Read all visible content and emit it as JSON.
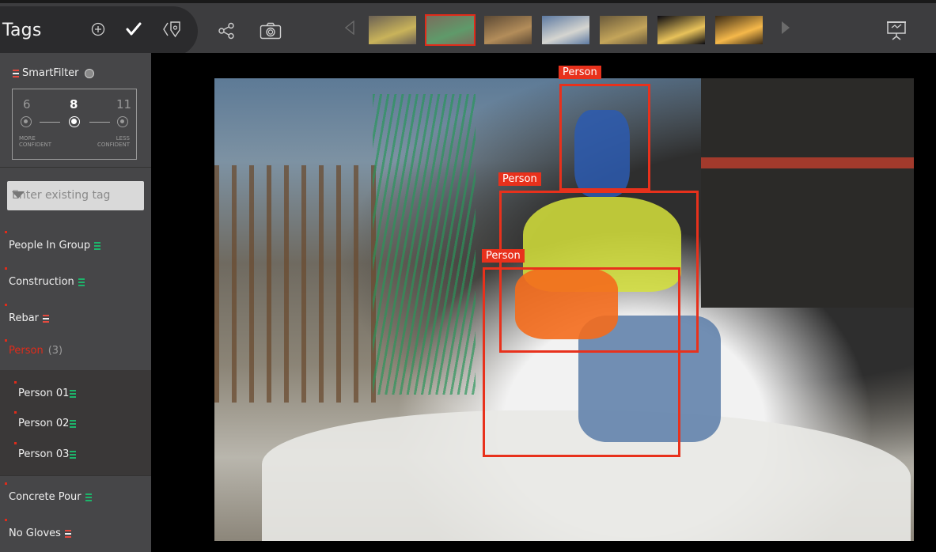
{
  "header": {
    "title": "Tags",
    "icons": [
      "add-circle-icon",
      "check-icon",
      "tag-location-icon",
      "share-icon",
      "camera-icon",
      "prev-arrow-icon",
      "next-arrow-icon",
      "presentation-icon"
    ]
  },
  "thumbnails": [
    {
      "name": "thumb-1",
      "active": false,
      "colors": [
        "#6b6154",
        "#c9b35a"
      ]
    },
    {
      "name": "thumb-2",
      "active": true,
      "colors": [
        "#7a6e5d",
        "#5f9a6a"
      ]
    },
    {
      "name": "thumb-3",
      "active": false,
      "colors": [
        "#5d4a35",
        "#b38d5a"
      ]
    },
    {
      "name": "thumb-4",
      "active": false,
      "colors": [
        "#5d7aa2",
        "#d5d5d0"
      ]
    },
    {
      "name": "thumb-5",
      "active": false,
      "colors": [
        "#6a5a3b",
        "#c4a55a"
      ]
    },
    {
      "name": "thumb-6",
      "active": false,
      "colors": [
        "#0a0a12",
        "#e8c25a"
      ]
    },
    {
      "name": "thumb-7",
      "active": false,
      "colors": [
        "#3a2a16",
        "#f5b84a"
      ]
    }
  ],
  "smartfilter": {
    "label": "SmartFilter",
    "values": [
      "6",
      "8",
      "11"
    ],
    "selected_index": 1,
    "left_caption": [
      "MORE",
      "CONFIDENT"
    ],
    "right_caption": [
      "LESS",
      "CONFIDENT"
    ]
  },
  "tag_input": {
    "placeholder": "Enter existing tag"
  },
  "tags": [
    {
      "label": "People In Group",
      "confidence": "green"
    },
    {
      "label": "Construction",
      "confidence": "green"
    },
    {
      "label": "Rebar",
      "confidence": "red"
    }
  ],
  "person_group": {
    "label": "Person",
    "count": "(3)",
    "items": [
      {
        "label": "Person 01",
        "confidence": "green"
      },
      {
        "label": "Person 02",
        "confidence": "green"
      },
      {
        "label": "Person 03",
        "confidence": "green"
      }
    ]
  },
  "tags_after": [
    {
      "label": "Concrete Pour",
      "confidence": "green"
    },
    {
      "label": "No Gloves",
      "confidence": "red"
    }
  ],
  "detections": [
    {
      "label": "Person"
    },
    {
      "label": "Person"
    },
    {
      "label": "Person"
    }
  ],
  "colors": {
    "accent_red": "#e8311c",
    "confidence_green": "#1db56b",
    "confidence_red": "#e54a3f"
  }
}
